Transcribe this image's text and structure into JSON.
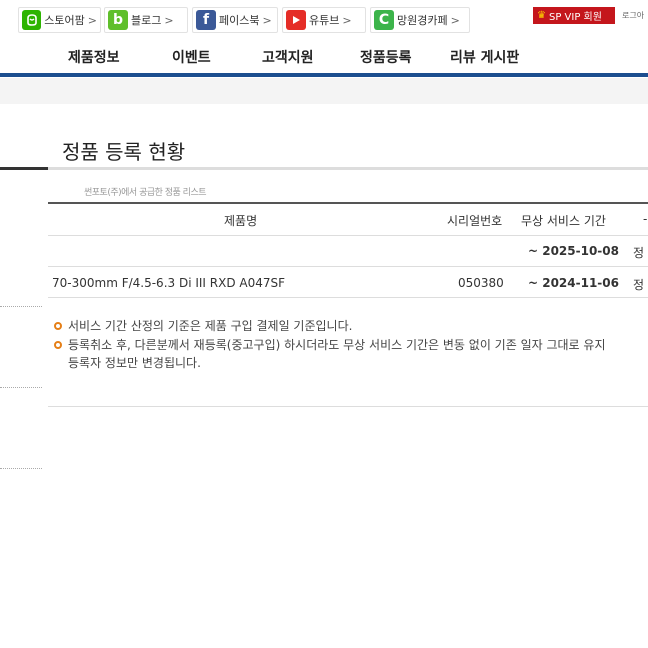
{
  "topbar": {
    "links": [
      {
        "label": "스토어팜",
        "icon": "smartstore-icon",
        "color": "#2db400"
      },
      {
        "label": "블로그",
        "icon": "blog-icon",
        "color": "#5fbf2b"
      },
      {
        "label": "페이스북",
        "icon": "facebook-icon",
        "color": "#3b5998"
      },
      {
        "label": "유튜브",
        "icon": "youtube-icon",
        "color": "#e52d27"
      },
      {
        "label": "망원경카페",
        "icon": "cafe-icon",
        "color": "#3cb44a"
      }
    ],
    "vip_label": "SP VIP 회원",
    "login_label": "로그아"
  },
  "nav": {
    "items": [
      "제품정보",
      "이벤트",
      "고객지원",
      "정품등록",
      "리뷰 게시판"
    ],
    "accent": "#1c4e8f"
  },
  "page": {
    "title": "정품 등록 현황",
    "subtitle": "썬포토(주)에서 공급한 정품 리스트"
  },
  "table": {
    "headers": [
      "제품명",
      "시리얼번호",
      "무상 서비스 기간",
      "-"
    ],
    "rows": [
      {
        "product": "",
        "serial": "",
        "period": "~ 2025-10-08",
        "status": "정"
      },
      {
        "product": "70-300mm F/4.5-6.3 Di III RXD A047SF",
        "serial": "050380",
        "period": "~ 2024-11-06",
        "status": "정"
      }
    ]
  },
  "notes": [
    "서비스 기간 산정의 기준은 제품 구입 결제일 기준입니다.",
    "등록취소 후, 다른분께서 재등록(중고구입) 하시더라도 무상 서비스 기간은 변동 없이 기존 일자 그대로 유지",
    "등록자 정보만 변경됩니다."
  ]
}
